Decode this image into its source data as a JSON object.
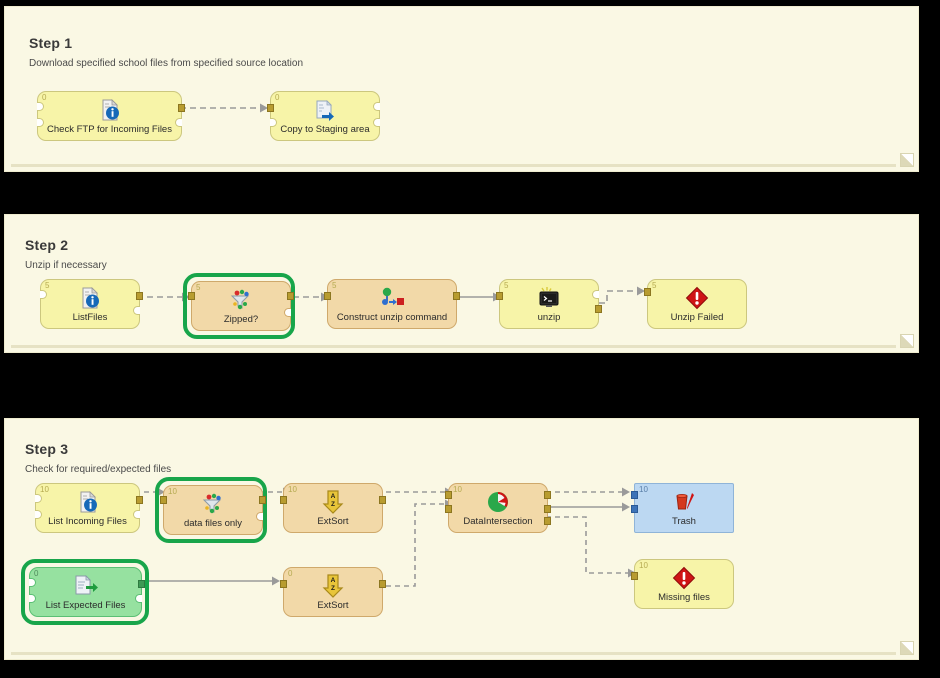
{
  "canvas": {
    "background": "#000000",
    "panel_fill": "#faf8e4",
    "node_yellow": "#f7f4a8",
    "node_orange": "#f2d9a8",
    "node_green": "#96e1a0",
    "node_blue": "#bcd8f2",
    "selection_ring": "#18a54a",
    "port_color": "#b89c30",
    "wire_color": "#9a9a9a"
  },
  "panels": [
    {
      "id": "step1",
      "title": "Step 1",
      "subtitle": "Download specified school files from specified source location"
    },
    {
      "id": "step2",
      "title": "Step 2",
      "subtitle": "Unzip if necessary"
    },
    {
      "id": "step3",
      "title": "Step 3",
      "subtitle": "Check for required/expected files"
    }
  ],
  "nodes": {
    "check_ftp": {
      "label": "Check FTP for Incoming Files",
      "number": "0",
      "icon": "file-info-icon",
      "color": "yellow",
      "selected": false
    },
    "copy_staging": {
      "label": "Copy to Staging area",
      "number": "0",
      "icon": "file-copy-arrow-icon",
      "color": "yellow",
      "selected": false
    },
    "list_files": {
      "label": "ListFiles",
      "number": "5",
      "icon": "file-info-icon",
      "color": "yellow",
      "selected": false
    },
    "zipped": {
      "label": "Zipped?",
      "number": "5",
      "icon": "row-filter-icon",
      "color": "orange",
      "selected": true
    },
    "construct_unzip": {
      "label": "Construct unzip command",
      "number": "5",
      "icon": "string-manip-icon",
      "color": "orange",
      "selected": false
    },
    "unzip": {
      "label": "unzip",
      "number": "5",
      "icon": "terminal-icon",
      "color": "yellow",
      "selected": false
    },
    "unzip_failed": {
      "label": "Unzip Failed",
      "number": "5",
      "icon": "red-alert-diamond-icon",
      "color": "yellow",
      "selected": false
    },
    "list_incoming": {
      "label": "List Incoming Files",
      "number": "10",
      "icon": "file-info-icon",
      "color": "yellow",
      "selected": false
    },
    "data_files_only": {
      "label": "data files only",
      "number": "10",
      "icon": "row-filter-icon",
      "color": "orange",
      "selected": true
    },
    "extsort_top": {
      "label": "ExtSort",
      "number": "10",
      "icon": "sort-az-arrow-icon",
      "color": "orange",
      "selected": false
    },
    "data_intersect": {
      "label": "DataIntersection",
      "number": "10",
      "icon": "intersection-pie-icon",
      "color": "orange",
      "selected": false
    },
    "trash": {
      "label": "Trash",
      "number": "10",
      "icon": "trash-icon",
      "color": "blue",
      "selected": false
    },
    "list_expected": {
      "label": "List Expected Files",
      "number": "0",
      "icon": "list-export-icon",
      "color": "green",
      "selected": true
    },
    "extsort_bottom": {
      "label": "ExtSort",
      "number": "0",
      "icon": "sort-az-arrow-icon",
      "color": "orange",
      "selected": false
    },
    "missing_files": {
      "label": "Missing files",
      "number": "10",
      "icon": "red-alert-diamond-icon",
      "color": "yellow",
      "selected": false
    }
  },
  "connections": [
    {
      "from": "check_ftp",
      "to": "copy_staging",
      "style": "dashed"
    },
    {
      "from": "list_files",
      "to": "zipped",
      "style": "dashed"
    },
    {
      "from": "zipped",
      "to": "construct_unzip",
      "style": "dashed"
    },
    {
      "from": "construct_unzip",
      "to": "unzip",
      "style": "solid"
    },
    {
      "from": "unzip",
      "to": "unzip_failed",
      "style": "dashed"
    },
    {
      "from": "list_incoming",
      "to": "data_files_only",
      "style": "dashed"
    },
    {
      "from": "data_files_only",
      "to": "extsort_top",
      "style": "dashed"
    },
    {
      "from": "extsort_top",
      "to": "data_intersect",
      "style": "dashed"
    },
    {
      "from": "list_expected",
      "to": "extsort_bottom",
      "style": "solid"
    },
    {
      "from": "extsort_bottom",
      "to": "data_intersect",
      "style": "dashed"
    },
    {
      "from": "data_intersect",
      "to": "trash",
      "style": "dashed"
    },
    {
      "from": "data_intersect",
      "to": "trash",
      "style": "solid"
    },
    {
      "from": "data_intersect",
      "to": "missing_files",
      "style": "dashed"
    }
  ]
}
